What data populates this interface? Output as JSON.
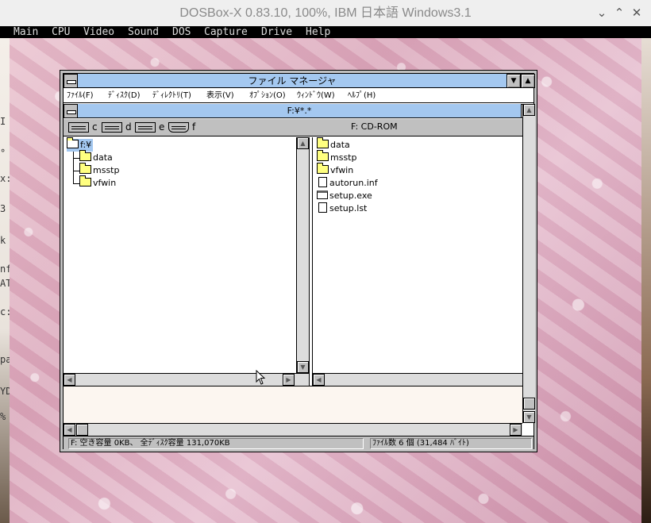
{
  "host": {
    "title": "DOSBox-X 0.83.10, 100%, IBM 日本語 Windows3.1",
    "menu": [
      "Main",
      "CPU",
      "Video",
      "Sound",
      "DOS",
      "Capture",
      "Drive",
      "Help"
    ],
    "minimize": "⌄",
    "maximize": "⌃",
    "close": "✕"
  },
  "left_strip": [
    "I",
    "°",
    "x:",
    "3",
    "k",
    "nf",
    "AT",
    "c:",
    "pa",
    "YD",
    "%"
  ],
  "file_manager": {
    "title": "ファイル マネージャ",
    "menu": [
      "ﾌｧｲﾙ(F)",
      "ﾃﾞｨｽｸ(D)",
      "ﾃﾞｨﾚｸﾄﾘ(T)",
      "表示(V)",
      "ｵﾌﾟｼｮﾝ(O)",
      "ｳｨﾝﾄﾞｳ(W)",
      "ﾍﾙﾌﾟ(H)"
    ],
    "child_title": "F:¥*.*",
    "drives": [
      "c",
      "d",
      "e",
      "f"
    ],
    "current_drive_label": "F: CD-ROM",
    "tree": {
      "root": "f:¥",
      "children": [
        "data",
        "msstp",
        "vfwin"
      ]
    },
    "files": [
      {
        "name": "data",
        "kind": "folder"
      },
      {
        "name": "msstp",
        "kind": "folder"
      },
      {
        "name": "vfwin",
        "kind": "folder"
      },
      {
        "name": "autorun.inf",
        "kind": "file"
      },
      {
        "name": "setup.exe",
        "kind": "exe"
      },
      {
        "name": "setup.lst",
        "kind": "file"
      }
    ],
    "status_left": "F: 空き容量 0KB、 全ﾃﾞｨｽｸ容量 131,070KB",
    "status_right": "ﾌｧｲﾙ数 6 個 (31,484 ﾊﾞｲﾄ)"
  },
  "icons": {
    "folder": "folder-icon",
    "open_folder": "open-folder-icon",
    "file": "document-icon",
    "exe": "application-icon",
    "drive": "drive-icon",
    "cd": "cdrom-drive-icon"
  },
  "colors": {
    "title_active": "#a4c8f0",
    "folder_yellow": "#ffff80",
    "selection": "#a4c8f0"
  }
}
